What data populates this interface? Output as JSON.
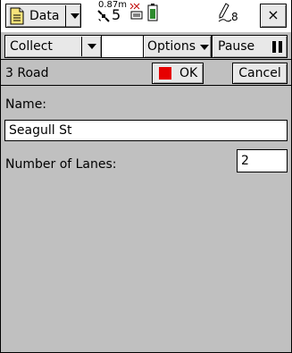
{
  "topbar": {
    "app_menu_label": "Data",
    "gps_accuracy": "0.87m",
    "satellite_count": "5",
    "pen_count": "8",
    "close_glyph": "×"
  },
  "toolbar": {
    "collect_label": "Collect",
    "options_label": "Options",
    "pause_label": "Pause"
  },
  "form": {
    "feature_title": "3 Road",
    "ok_label": "OK",
    "cancel_label": "Cancel",
    "fields": [
      {
        "label": "Name:",
        "value": "Seagull St"
      },
      {
        "label": "Number of Lanes:",
        "value": "2"
      }
    ]
  },
  "colors": {
    "body_background": "#c0c0c0",
    "ok_indicator": "#e60000",
    "battery_fill": "#2e8b2e"
  },
  "icons": {
    "app": "document-icon",
    "satellite": "satellite-icon",
    "radio": "radio-signal-icon",
    "battery": "battery-icon",
    "pen": "pen-icon"
  }
}
